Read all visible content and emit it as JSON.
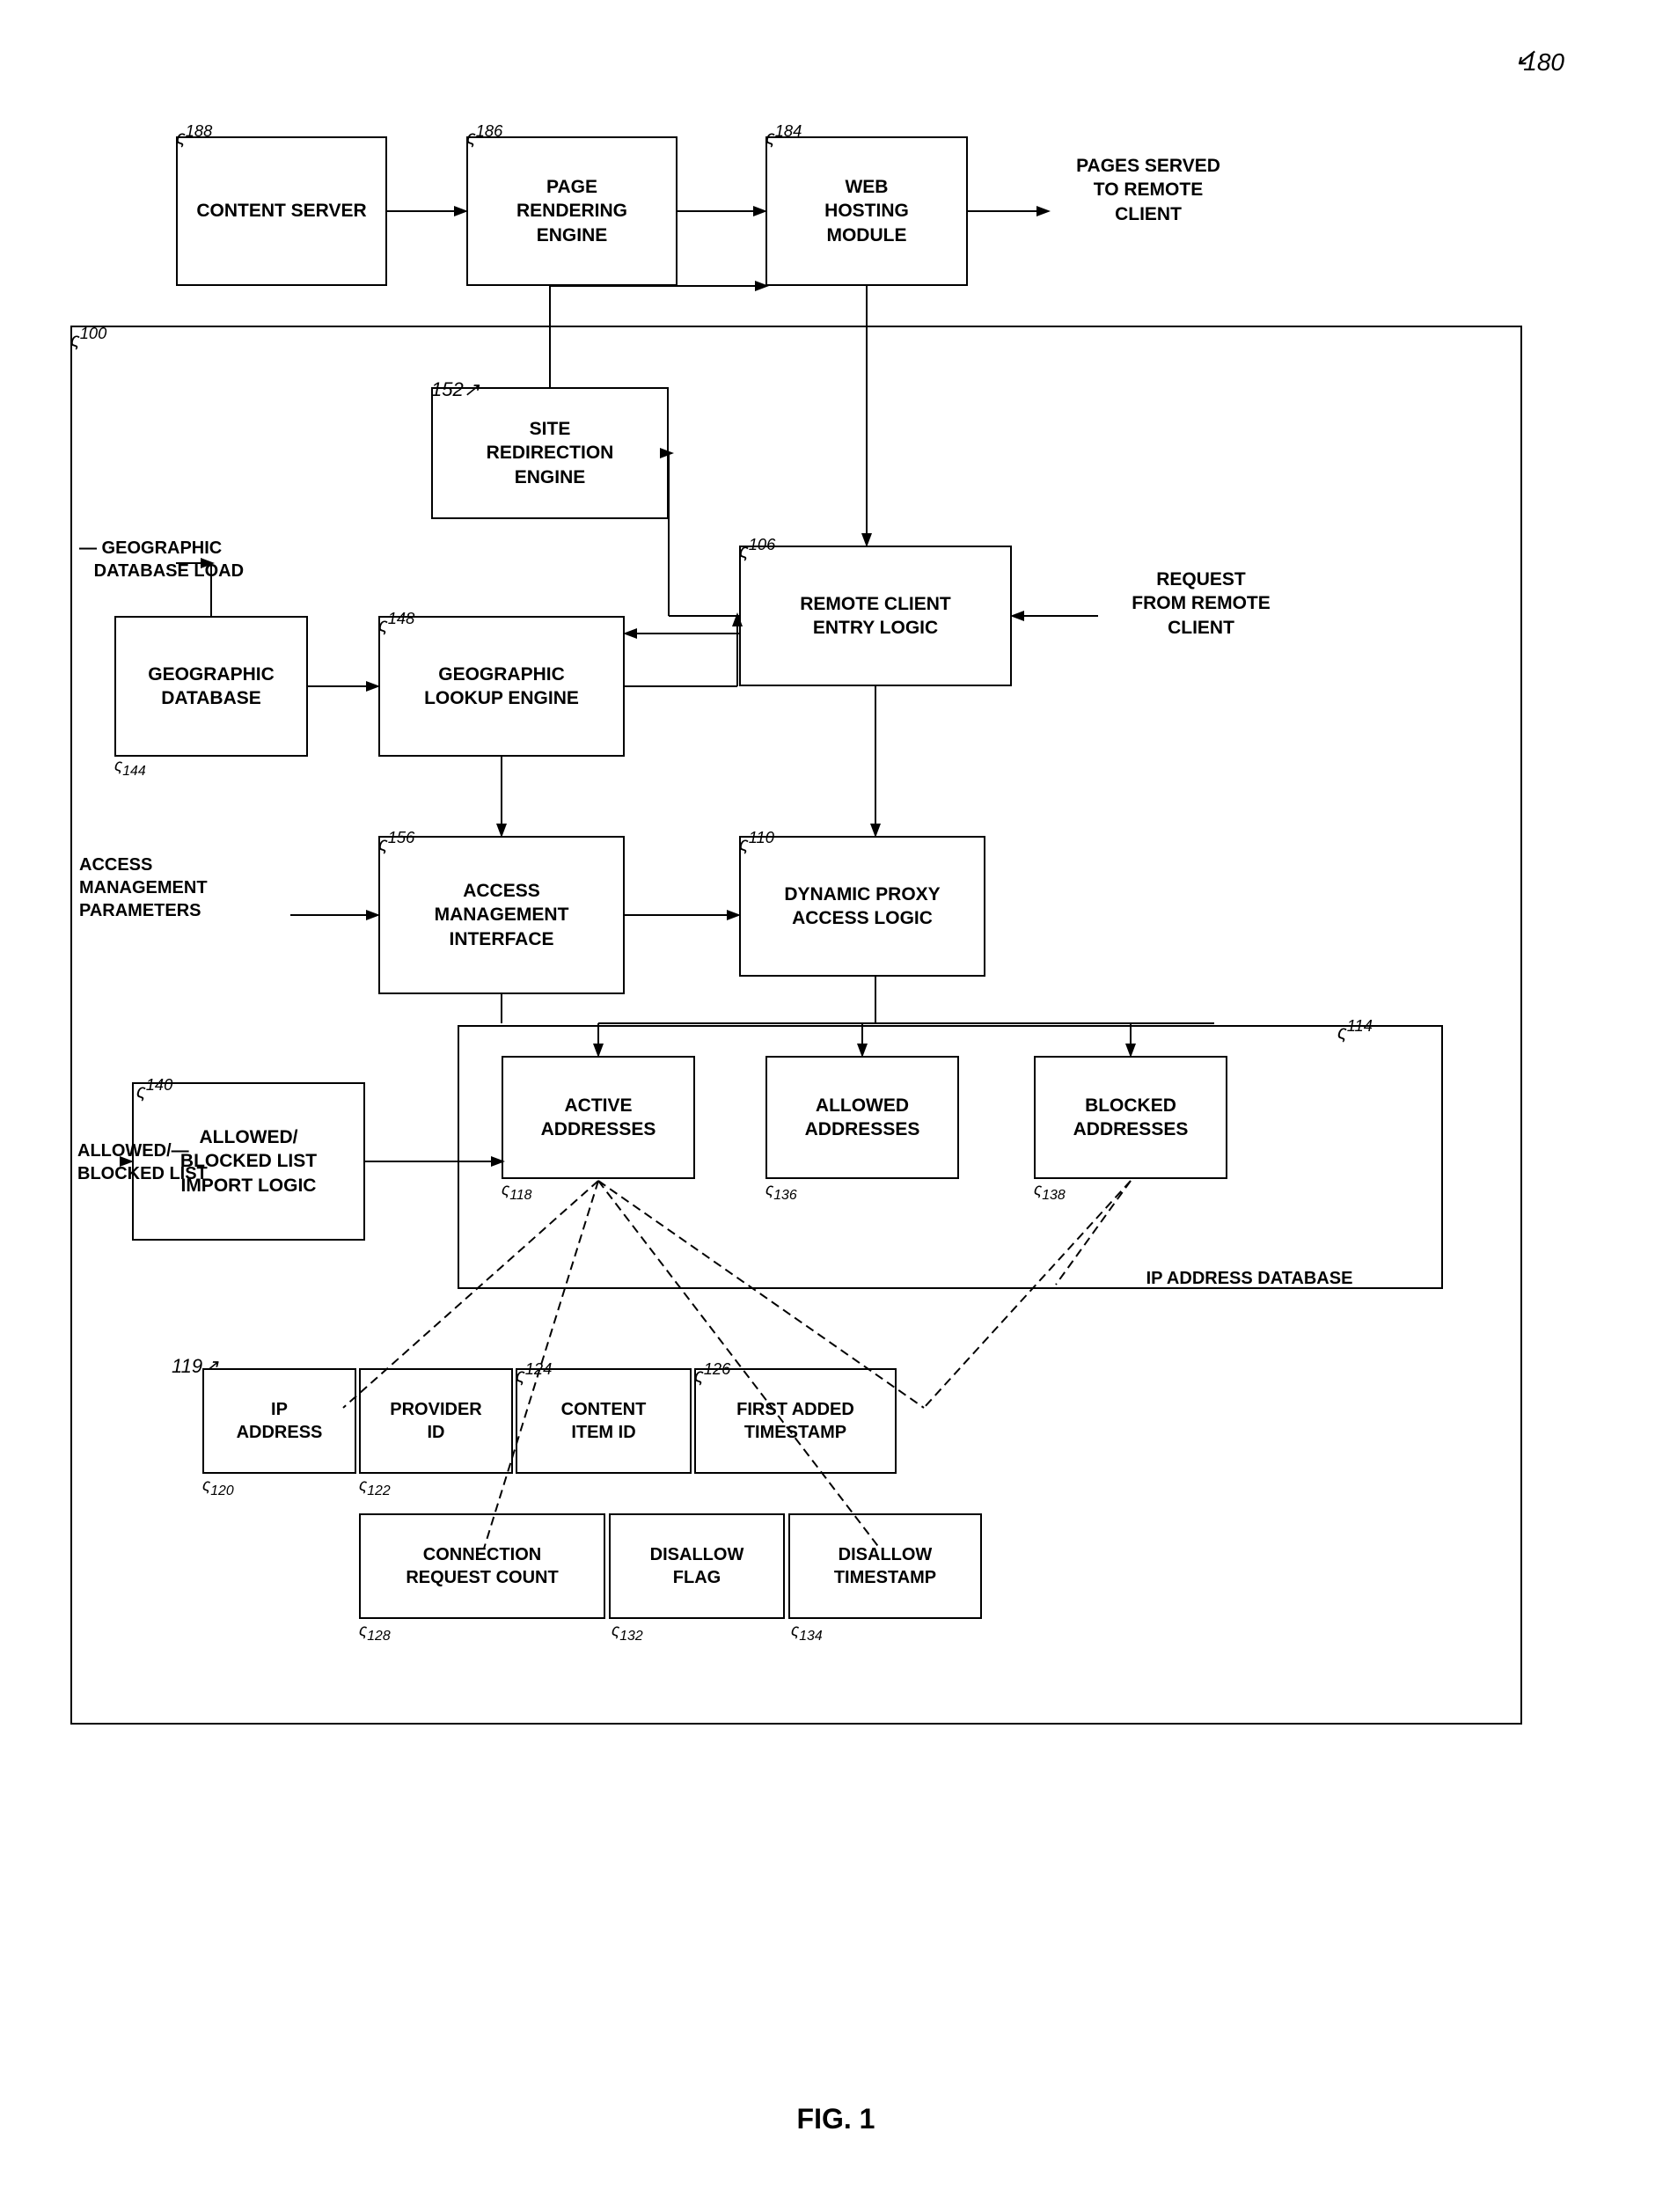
{
  "figure": {
    "number": "FIG. 1",
    "ref": "180"
  },
  "boxes": {
    "content_server": {
      "label": "CONTENT\nSERVER",
      "ref": "188"
    },
    "page_rendering_engine": {
      "label": "PAGE\nRENDERING\nENGINE",
      "ref": "186"
    },
    "web_hosting_module": {
      "label": "WEB\nHOSTING\nMODULE",
      "ref": "184"
    },
    "pages_served": {
      "label": "PAGES SERVED\nTO REMOTE\nCLIENT"
    },
    "site_redirection": {
      "label": "SITE\nREDIRECTION\nENGINE",
      "ref": "152"
    },
    "remote_client_entry": {
      "label": "REMOTE CLIENT\nENTRY LOGIC",
      "ref": "106"
    },
    "request_from_client": {
      "label": "REQUEST\nFROM REMOTE\nCLIENT"
    },
    "geographic_database": {
      "label": "GEOGRAPHIC\nDATABASE",
      "ref": "144"
    },
    "geographic_lookup": {
      "label": "GEOGRAPHIC\nLOOKUP ENGINE",
      "ref": "148"
    },
    "access_management": {
      "label": "ACCESS\nMANAGEMENT\nINTERFACE",
      "ref": "156"
    },
    "dynamic_proxy": {
      "label": "DYNAMIC PROXY\nACCESS LOGIC",
      "ref": "110"
    },
    "geo_db_load": {
      "label": "GEOGRAPHIC\nDATABASE LOAD"
    },
    "access_mgmt_params": {
      "label": "ACCESS\nMANAGEMENT\nPARAMETERS"
    },
    "allowed_blocked_import": {
      "label": "ALLOWED/\nBLOCKED LIST\nIMPORT LOGIC",
      "ref": "140"
    },
    "allowed_blocked_list": {
      "label": "ALLOWED/\nBLOCKED LIST"
    },
    "ip_address_db": {
      "label": "IP ADDRESS DATABASE"
    },
    "active_addresses": {
      "label": "ACTIVE\nADDRESSES",
      "ref": "118"
    },
    "allowed_addresses": {
      "label": "ALLOWED\nADDRESSES",
      "ref": "136"
    },
    "blocked_addresses": {
      "label": "BLOCKED\nADDRESSES",
      "ref": "138"
    },
    "ip_address_field": {
      "label": "IP\nADDRESS",
      "ref": "120"
    },
    "provider_id": {
      "label": "PROVIDER\nID",
      "ref": "122"
    },
    "content_item_id": {
      "label": "CONTENT\nITEM ID",
      "ref": "124"
    },
    "first_added_ts": {
      "label": "FIRST ADDED\nTIMESTAMP",
      "ref": "126"
    },
    "connection_req": {
      "label": "CONNECTION\nREQUEST COUNT",
      "ref": "128"
    },
    "disallow_flag": {
      "label": "DISALLOW\nFLAG",
      "ref": "132"
    },
    "disallow_ts": {
      "label": "DISALLOW\nTIMESTAMP",
      "ref": "134"
    },
    "record_ref": {
      "ref": "119"
    }
  }
}
